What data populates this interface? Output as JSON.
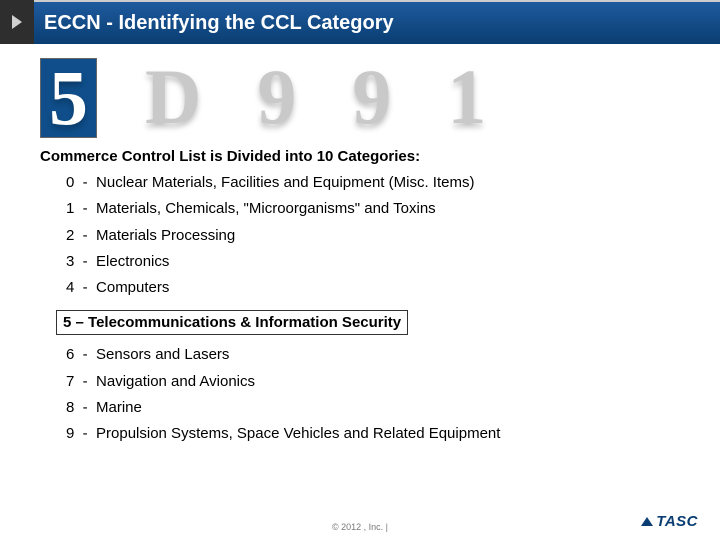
{
  "header": {
    "title": "ECCN - Identifying the CCL Category"
  },
  "code": {
    "digits": [
      "5",
      "D",
      "9",
      "9",
      "1"
    ],
    "activeIndex": 0
  },
  "subhead": "Commerce Control List is Divided into 10 Categories:",
  "categories_top": [
    {
      "num": "0",
      "label": "Nuclear Materials, Facilities and Equipment (Misc. Items)"
    },
    {
      "num": "1",
      "label": "Materials, Chemicals, \"Microorganisms\" and Toxins"
    },
    {
      "num": "2",
      "label": "Materials Processing"
    },
    {
      "num": "3",
      "label": "Electronics"
    },
    {
      "num": "4",
      "label": "Computers"
    }
  ],
  "highlight": "5 – Telecommunications & Information Security",
  "categories_bottom": [
    {
      "num": "6",
      "label": "Sensors and Lasers"
    },
    {
      "num": "7",
      "label": "Navigation and Avionics"
    },
    {
      "num": "8",
      "label": "Marine"
    },
    {
      "num": "9",
      "label": "Propulsion Systems, Space Vehicles and Related Equipment"
    }
  ],
  "footer": {
    "copyright": "© 2012 , Inc. |",
    "brand": "TASC"
  }
}
